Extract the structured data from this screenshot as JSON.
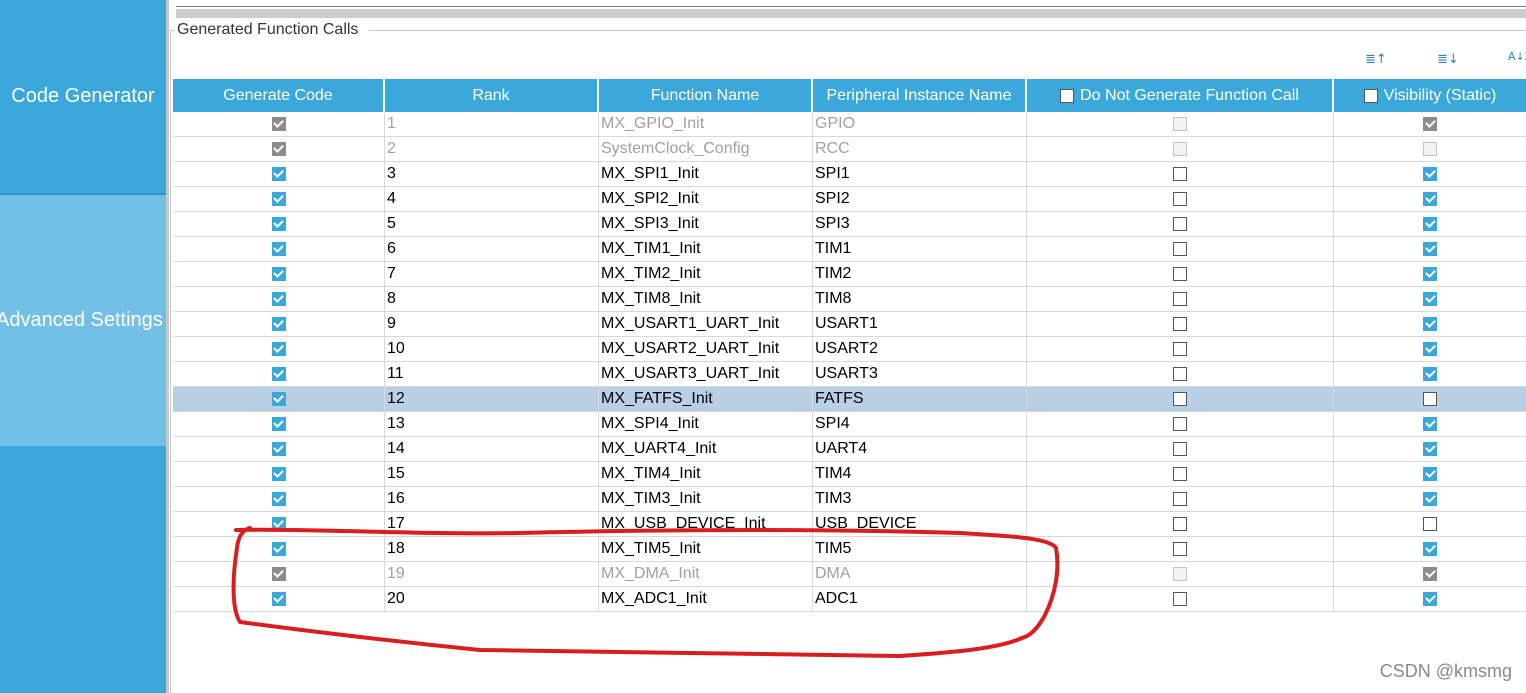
{
  "sidebar": {
    "items": [
      {
        "label": "Code Generator"
      },
      {
        "label": "Advanced Settings"
      }
    ]
  },
  "group": {
    "title": "Generated Function Calls"
  },
  "toolbar": {
    "icons": [
      "move-up-icon",
      "move-down-icon",
      "sort-alpha-icon"
    ],
    "sort_glyphs": [
      "≣↑",
      "≣↓",
      "A↓Z"
    ]
  },
  "table": {
    "headers": [
      "Generate Code",
      "Rank",
      "Function Name",
      "Peripheral Instance Name",
      "Do Not Generate Function Call",
      "Visibility (Static)"
    ],
    "rows": [
      {
        "generate": true,
        "rank": "1",
        "function": "MX_GPIO_Init",
        "peripheral": "GPIO",
        "no_call": false,
        "visibility": true,
        "disabled": true
      },
      {
        "generate": true,
        "rank": "2",
        "function": "SystemClock_Config",
        "peripheral": "RCC",
        "no_call": false,
        "visibility": false,
        "disabled": true
      },
      {
        "generate": true,
        "rank": "3",
        "function": "MX_SPI1_Init",
        "peripheral": "SPI1",
        "no_call": false,
        "visibility": true,
        "disabled": false
      },
      {
        "generate": true,
        "rank": "4",
        "function": "MX_SPI2_Init",
        "peripheral": "SPI2",
        "no_call": false,
        "visibility": true,
        "disabled": false
      },
      {
        "generate": true,
        "rank": "5",
        "function": "MX_SPI3_Init",
        "peripheral": "SPI3",
        "no_call": false,
        "visibility": true,
        "disabled": false
      },
      {
        "generate": true,
        "rank": "6",
        "function": "MX_TIM1_Init",
        "peripheral": "TIM1",
        "no_call": false,
        "visibility": true,
        "disabled": false
      },
      {
        "generate": true,
        "rank": "7",
        "function": "MX_TIM2_Init",
        "peripheral": "TIM2",
        "no_call": false,
        "visibility": true,
        "disabled": false
      },
      {
        "generate": true,
        "rank": "8",
        "function": "MX_TIM8_Init",
        "peripheral": "TIM8",
        "no_call": false,
        "visibility": true,
        "disabled": false
      },
      {
        "generate": true,
        "rank": "9",
        "function": "MX_USART1_UART_Init",
        "peripheral": "USART1",
        "no_call": false,
        "visibility": true,
        "disabled": false
      },
      {
        "generate": true,
        "rank": "10",
        "function": "MX_USART2_UART_Init",
        "peripheral": "USART2",
        "no_call": false,
        "visibility": true,
        "disabled": false
      },
      {
        "generate": true,
        "rank": "11",
        "function": "MX_USART3_UART_Init",
        "peripheral": "USART3",
        "no_call": false,
        "visibility": true,
        "disabled": false
      },
      {
        "generate": true,
        "rank": "12",
        "function": "MX_FATFS_Init",
        "peripheral": "FATFS",
        "no_call": false,
        "visibility": false,
        "disabled": false,
        "selected": true
      },
      {
        "generate": true,
        "rank": "13",
        "function": "MX_SPI4_Init",
        "peripheral": "SPI4",
        "no_call": false,
        "visibility": true,
        "disabled": false
      },
      {
        "generate": true,
        "rank": "14",
        "function": "MX_UART4_Init",
        "peripheral": "UART4",
        "no_call": false,
        "visibility": true,
        "disabled": false
      },
      {
        "generate": true,
        "rank": "15",
        "function": "MX_TIM4_Init",
        "peripheral": "TIM4",
        "no_call": false,
        "visibility": true,
        "disabled": false
      },
      {
        "generate": true,
        "rank": "16",
        "function": "MX_TIM3_Init",
        "peripheral": "TIM3",
        "no_call": false,
        "visibility": true,
        "disabled": false
      },
      {
        "generate": true,
        "rank": "17",
        "function": "MX_USB_DEVICE_Init",
        "peripheral": "USB_DEVICE",
        "no_call": false,
        "visibility": false,
        "disabled": false
      },
      {
        "generate": true,
        "rank": "18",
        "function": "MX_TIM5_Init",
        "peripheral": "TIM5",
        "no_call": false,
        "visibility": true,
        "disabled": false
      },
      {
        "generate": true,
        "rank": "19",
        "function": "MX_DMA_Init",
        "peripheral": "DMA",
        "no_call": false,
        "visibility": true,
        "disabled": true
      },
      {
        "generate": true,
        "rank": "20",
        "function": "MX_ADC1_Init",
        "peripheral": "ADC1",
        "no_call": false,
        "visibility": true,
        "disabled": false
      }
    ]
  },
  "annotation": {
    "color": "#d81e1e"
  },
  "watermark": "CSDN @kmsmg",
  "colors": {
    "accent": "#3ba8dc",
    "selected_row": "#b8cfe6",
    "sidebar_active": "#72c0e6"
  }
}
